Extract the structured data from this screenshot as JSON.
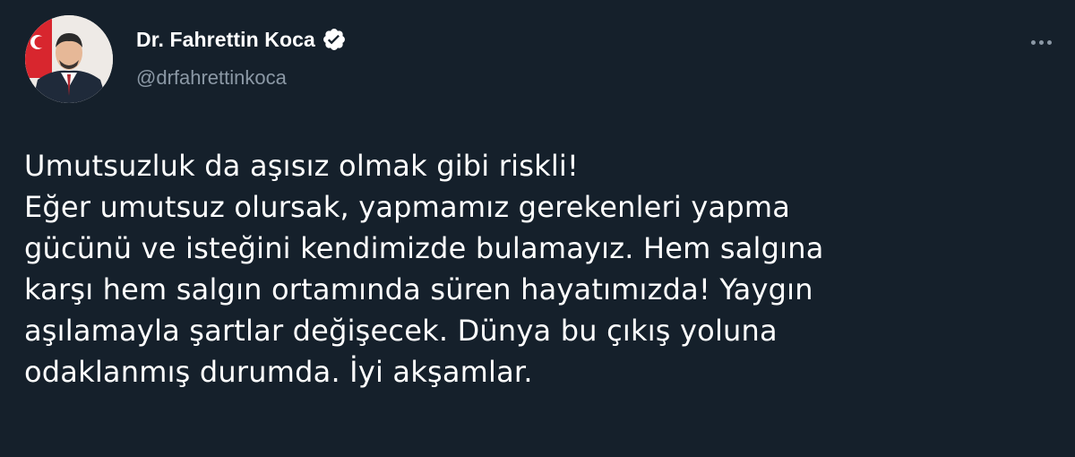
{
  "author": {
    "display_name": "Dr. Fahrettin Koca",
    "handle": "@drfahrettinkoca",
    "verified_icon": "verified-badge-icon",
    "avatar_icon": "profile-avatar"
  },
  "menu": {
    "icon": "more-options-icon"
  },
  "tweet": {
    "lines": [
      "Umutsuzluk da aşısız olmak gibi riskli!",
      "Eğer umutsuz olursak, yapmamız gerekenleri yapma",
      "gücünü ve isteğini kendimizde bulamayız. Hem salgına",
      "karşı hem salgın ortamında süren hayatımızda! Yaygın",
      "aşılamayla şartlar değişecek. Dünya bu çıkış yoluna",
      "odaklanmış durumda. İyi akşamlar."
    ]
  },
  "colors": {
    "background": "#15202b",
    "text_primary": "#ffffff",
    "text_secondary": "#8b98a5"
  }
}
